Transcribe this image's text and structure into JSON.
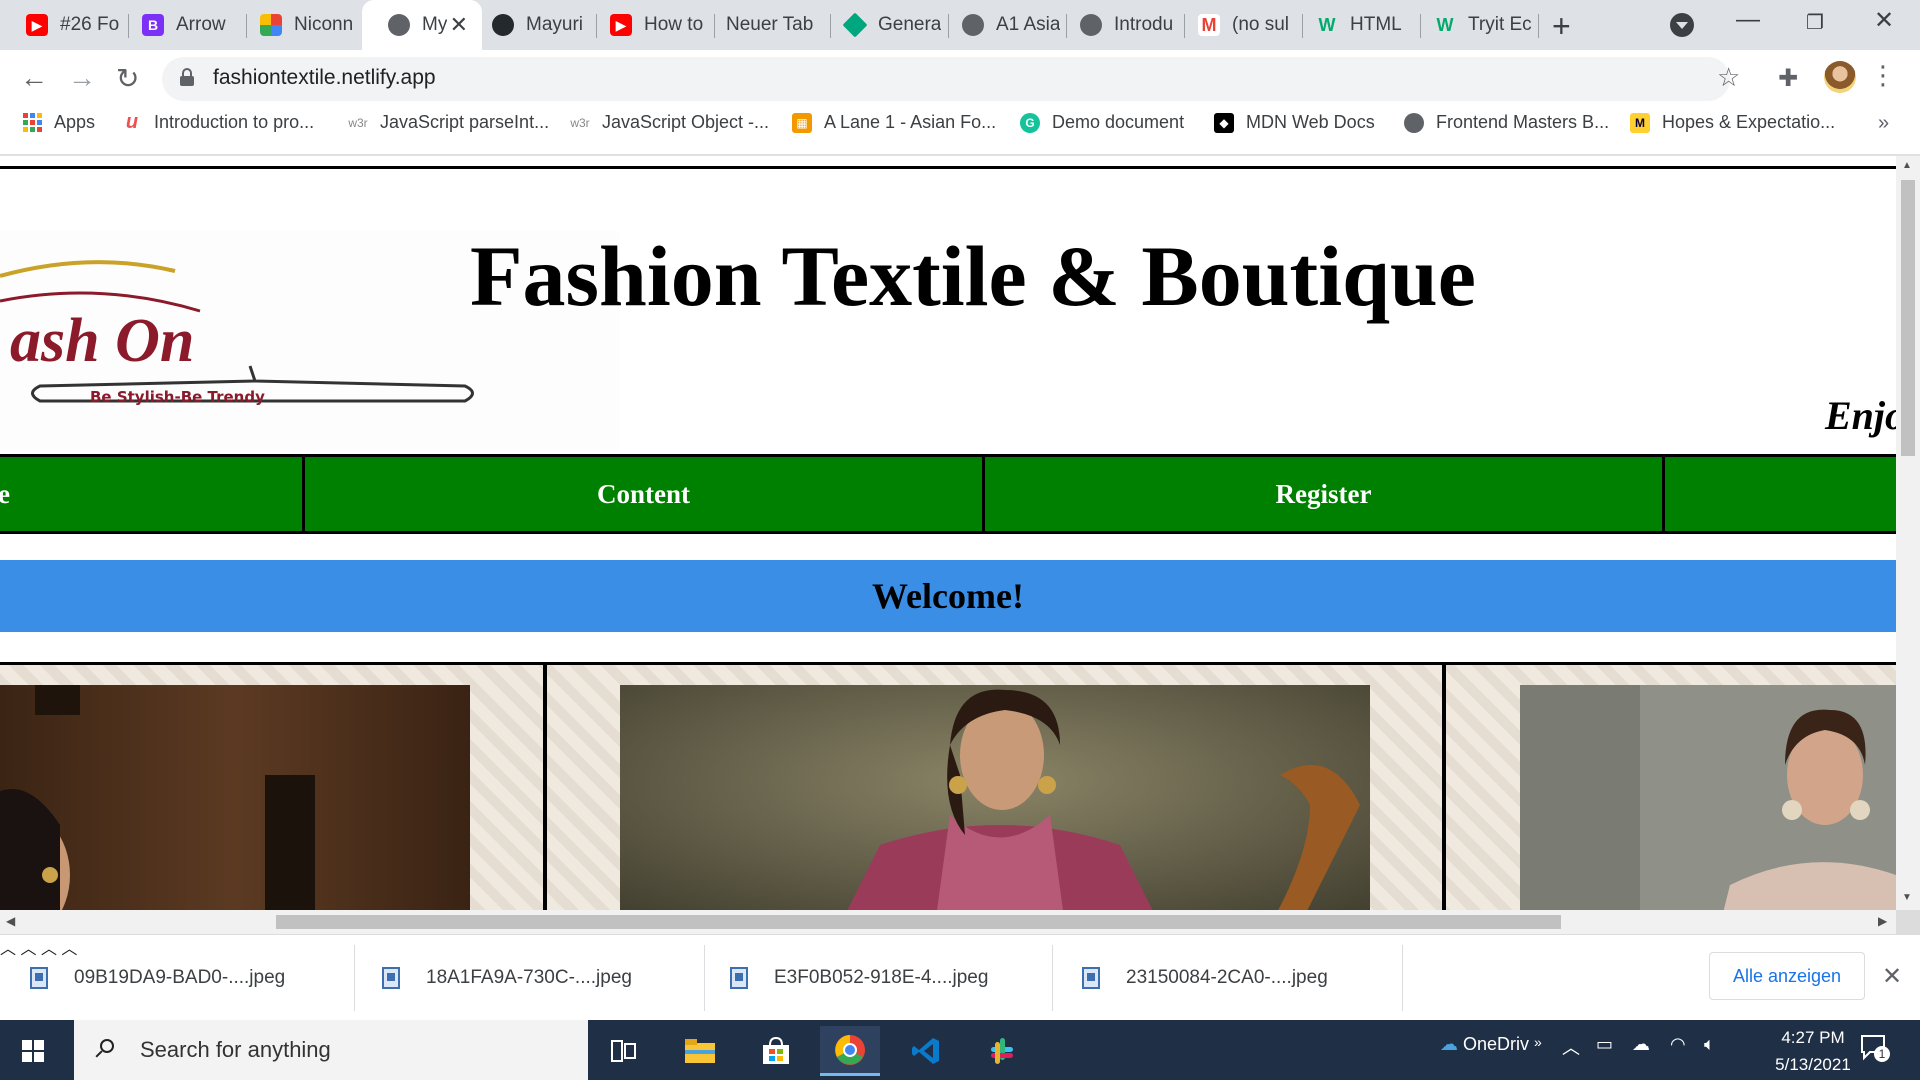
{
  "browser": {
    "tabs": [
      {
        "title": "#26 Fo",
        "favicon": "youtube-icon",
        "color": "#ff0000"
      },
      {
        "title": "Arrow",
        "favicon": "b-icon",
        "color": "#7b2ff7"
      },
      {
        "title": "Niconn",
        "favicon": "niconne-icon",
        "color": "#4285f4"
      },
      {
        "title": "My",
        "favicon": "globe-icon",
        "color": "#5f6368",
        "active": true
      },
      {
        "title": "Mayuri",
        "favicon": "github-icon",
        "color": "#24292e"
      },
      {
        "title": "How to",
        "favicon": "youtube-icon",
        "color": "#ff0000"
      },
      {
        "title": "Neuer Tab",
        "favicon": "",
        "color": ""
      },
      {
        "title": "Genera",
        "favicon": "diamond-icon",
        "color": "#00a67e"
      },
      {
        "title": "A1 Asia",
        "favicon": "globe-icon",
        "color": "#5f6368"
      },
      {
        "title": "Introdu",
        "favicon": "globe-icon",
        "color": "#5f6368"
      },
      {
        "title": "(no sul",
        "favicon": "gmail-icon",
        "color": "#ea4335"
      },
      {
        "title": "HTML",
        "favicon": "w3schools-icon",
        "color": "#04aa6d"
      },
      {
        "title": "Tryit Ec",
        "favicon": "w3schools-icon",
        "color": "#04aa6d"
      }
    ],
    "url": "fashiontextile.netlify.app",
    "bookmarks": [
      {
        "label": "Apps",
        "icon": "apps-grid-icon"
      },
      {
        "label": "Introduction to pro...",
        "icon": "udemy-icon"
      },
      {
        "label": "JavaScript parseInt...",
        "icon": "w3r-icon"
      },
      {
        "label": "JavaScript Object -...",
        "icon": "w3r-icon"
      },
      {
        "label": "A Lane 1 - Asian Fo...",
        "icon": "calendar-icon"
      },
      {
        "label": "Demo document",
        "icon": "grammarly-icon"
      },
      {
        "label": "MDN Web Docs",
        "icon": "mdn-icon"
      },
      {
        "label": "Frontend Masters B...",
        "icon": "globe-icon"
      },
      {
        "label": "Hopes & Expectatio...",
        "icon": "miro-icon"
      }
    ],
    "bookmarks_more": "»"
  },
  "page": {
    "logo_text": "ash On",
    "logo_tagline": "Be Stylish-Be Trendy",
    "title": "Fashion Textile & Boutique",
    "marquee": "Enjo",
    "nav": {
      "home_partial": "e",
      "content": "Content",
      "register": "Register"
    },
    "welcome": "Welcome!"
  },
  "downloads": {
    "items": [
      {
        "filename": "09B19DA9-BAD0-....jpeg"
      },
      {
        "filename": "18A1FA9A-730C-....jpeg"
      },
      {
        "filename": "E3F0B052-918E-4....jpeg"
      },
      {
        "filename": "23150084-2CA0-....jpeg"
      }
    ],
    "show_all": "Alle anzeigen"
  },
  "taskbar": {
    "search_placeholder": "Search for anything",
    "onedrive_label": "OneDriv",
    "time": "4:27 PM",
    "date": "5/13/2021",
    "notification_count": "1"
  },
  "colors": {
    "nav_green": "#008000",
    "welcome_blue": "#3a8ee6",
    "chrome_tabstrip": "#dee1e6",
    "taskbar": "#1f2f45"
  }
}
